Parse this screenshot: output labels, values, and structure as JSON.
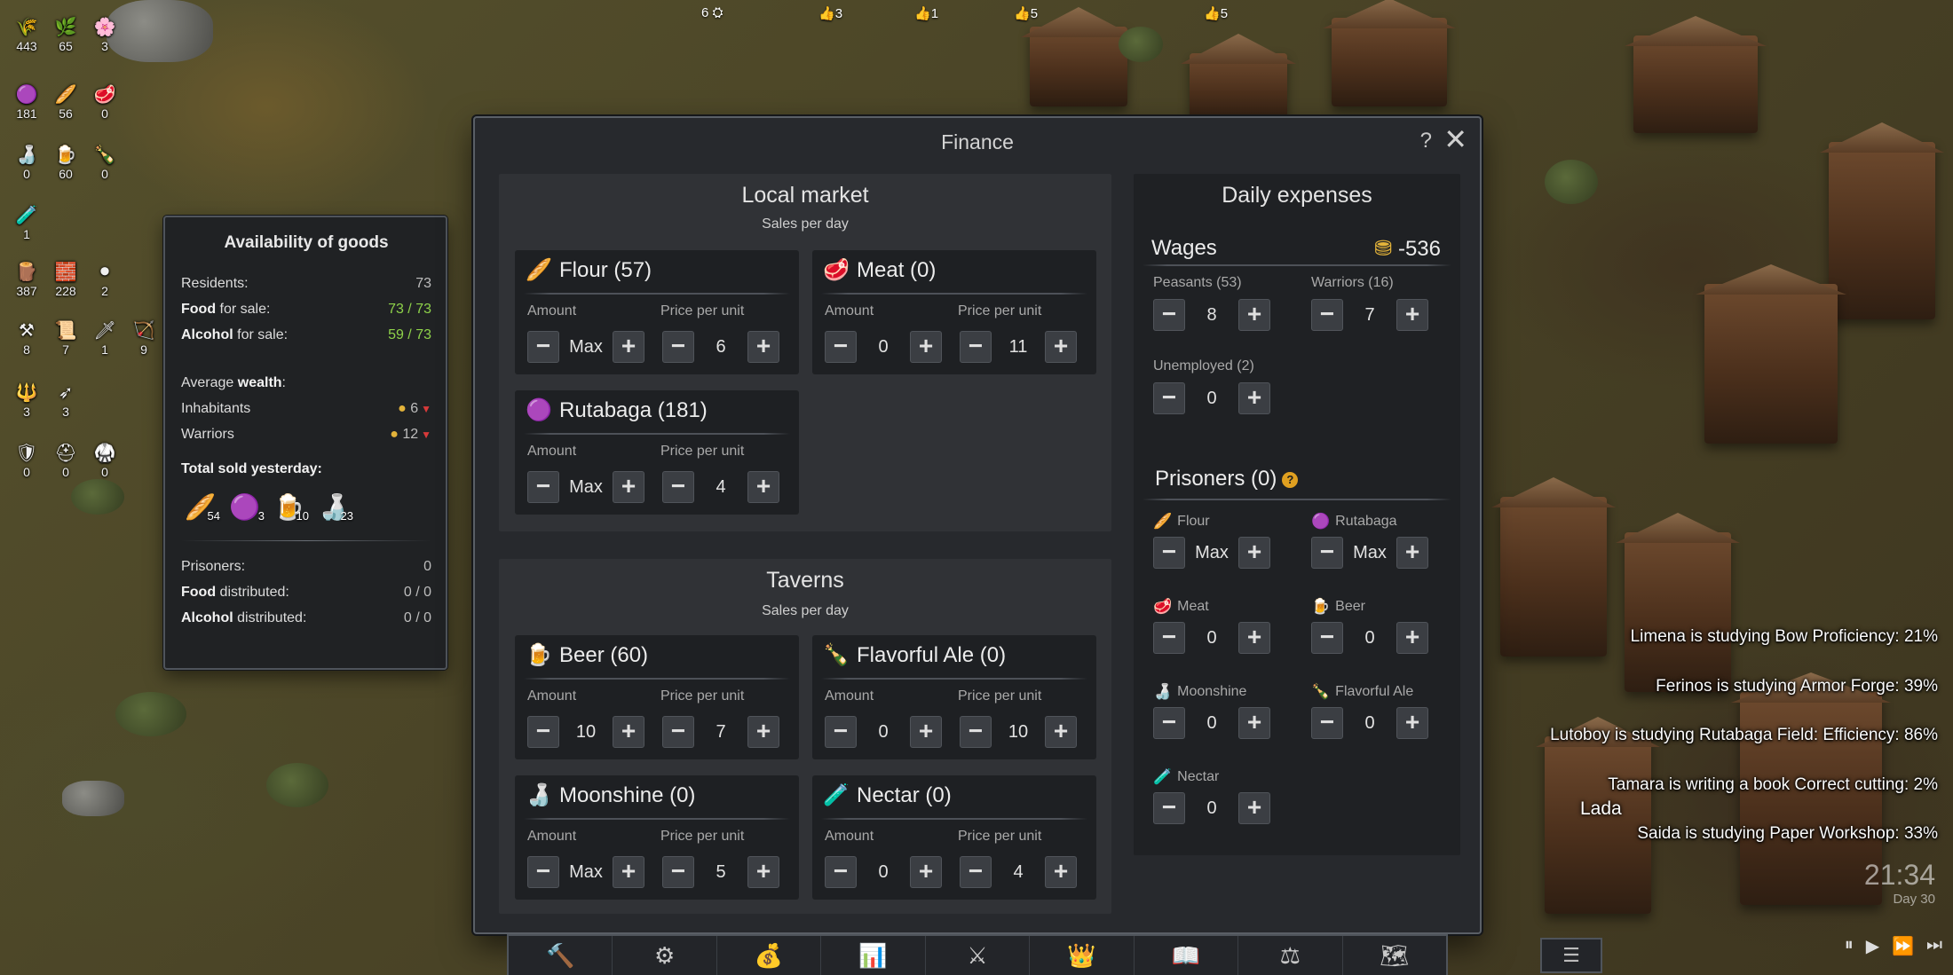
{
  "resources": [
    {
      "icon": "wheat-icon",
      "glyph": "🌾",
      "value": "443"
    },
    {
      "icon": "herb-icon",
      "glyph": "🌿",
      "value": "65"
    },
    {
      "icon": "flower-icon",
      "glyph": "🌸",
      "value": "3"
    },
    {
      "icon": "rutabaga-icon",
      "glyph": "🟣",
      "value": "181"
    },
    {
      "icon": "flour-icon",
      "glyph": "🥖",
      "value": "56"
    },
    {
      "icon": "meat-icon",
      "glyph": "🥩",
      "value": "0"
    },
    {
      "icon": "moonshine-icon",
      "glyph": "🍶",
      "value": "0"
    },
    {
      "icon": "beer-icon",
      "glyph": "🍺",
      "value": "60"
    },
    {
      "icon": "ale-icon",
      "glyph": "🍾",
      "value": "0"
    },
    {
      "icon": "nectar-icon",
      "glyph": "🧪",
      "value": "1"
    },
    {
      "icon": "wood-icon",
      "glyph": "🪵",
      "value": "387"
    },
    {
      "icon": "brick-icon",
      "glyph": "🧱",
      "value": "228"
    },
    {
      "icon": "ore-icon",
      "glyph": "⚫",
      "value": "2"
    },
    {
      "icon": "tools-icon",
      "glyph": "⚒",
      "value": "8"
    },
    {
      "icon": "scroll-icon",
      "glyph": "📜",
      "value": "7"
    },
    {
      "icon": "sword-icon",
      "glyph": "🗡",
      "value": "1"
    },
    {
      "icon": "bow-icon",
      "glyph": "🏹",
      "value": "9"
    },
    {
      "icon": "spear-icon",
      "glyph": "🔱",
      "value": "3"
    },
    {
      "icon": "arrow-icon",
      "glyph": "➶",
      "value": "3"
    },
    {
      "icon": "shield-icon",
      "glyph": "🛡",
      "value": "0"
    },
    {
      "icon": "helmet-icon",
      "glyph": "⛑",
      "value": "0"
    },
    {
      "icon": "armor-icon",
      "glyph": "🥋",
      "value": "0"
    }
  ],
  "top_counters": [
    {
      "icon": "soldier-icon",
      "text": "6"
    },
    {
      "icon": "thumb-icon",
      "text": "3"
    },
    {
      "icon": "thumb-icon",
      "text": "1"
    },
    {
      "icon": "thumb-icon",
      "text": "5"
    },
    {
      "icon": "thumb-icon",
      "text": "5"
    }
  ],
  "availability": {
    "title": "Availability of goods",
    "residents_label": "Residents:",
    "residents_value": "73",
    "food_bold": "Food",
    "food_rest": " for sale:",
    "food_value": "73 / 73",
    "alcohol_bold": "Alcohol",
    "alcohol_rest": " for sale:",
    "alcohol_value": "59 / 73",
    "avg_prefix": "Average ",
    "avg_bold": "wealth",
    "avg_suffix": ":",
    "inhabitants_label": "Inhabitants",
    "inhabitants_value": "6",
    "warriors_label": "Warriors",
    "warriors_value": "12",
    "sold_title": "Total sold yesterday:",
    "sold": [
      {
        "icon": "flour-icon",
        "glyph": "🥖",
        "count": "54"
      },
      {
        "icon": "rutabaga-icon",
        "glyph": "🟣",
        "count": "3"
      },
      {
        "icon": "beer-icon",
        "glyph": "🍺",
        "count": "10"
      },
      {
        "icon": "moonshine-icon",
        "glyph": "🍶",
        "count": "23"
      }
    ],
    "prisoners_label": "Prisoners:",
    "prisoners_value": "0",
    "food_dist_bold": "Food",
    "food_dist_rest": " distributed:",
    "food_dist_value": "0 / 0",
    "alcohol_dist_bold": "Alcohol",
    "alcohol_dist_rest": " distributed:",
    "alcohol_dist_value": "0 / 0"
  },
  "finance": {
    "title": "Finance",
    "help": "?",
    "close": "✕",
    "amount_label": "Amount",
    "price_label": "Price per unit",
    "local_market": {
      "title": "Local market",
      "subtitle": "Sales per day",
      "items": [
        {
          "name": "Flour (57)",
          "icon": "flour-icon",
          "glyph": "🥖",
          "amount": "Max",
          "price": "6"
        },
        {
          "name": "Meat (0)",
          "icon": "meat-icon",
          "glyph": "🥩",
          "amount": "0",
          "price": "11"
        },
        {
          "name": "Rutabaga (181)",
          "icon": "rutabaga-icon",
          "glyph": "🟣",
          "amount": "Max",
          "price": "4"
        }
      ]
    },
    "taverns": {
      "title": "Taverns",
      "subtitle": "Sales per day",
      "items": [
        {
          "name": "Beer (60)",
          "icon": "beer-icon",
          "glyph": "🍺",
          "amount": "10",
          "price": "7"
        },
        {
          "name": "Flavorful Ale (0)",
          "icon": "ale-icon",
          "glyph": "🍾",
          "amount": "0",
          "price": "10"
        },
        {
          "name": "Moonshine (0)",
          "icon": "moonshine-icon",
          "glyph": "🍶",
          "amount": "Max",
          "price": "5"
        },
        {
          "name": "Nectar (0)",
          "icon": "nectar-icon",
          "glyph": "🧪",
          "amount": "0",
          "price": "4"
        }
      ]
    },
    "expenses": {
      "title": "Daily expenses",
      "wages_label": "Wages",
      "wages_value": "-536",
      "peasants_label": "Peasants (53)",
      "peasants_value": "8",
      "warriors_label": "Warriors (16)",
      "warriors_value": "7",
      "unemployed_label": "Unemployed (2)",
      "unemployed_value": "0",
      "prisoners_title": "Prisoners (0)",
      "prisoner_items": [
        {
          "name": "Flour",
          "icon": "flour-icon",
          "glyph": "🥖",
          "value": "Max"
        },
        {
          "name": "Rutabaga",
          "icon": "rutabaga-icon",
          "glyph": "🟣",
          "value": "Max"
        },
        {
          "name": "Meat",
          "icon": "meat-icon",
          "glyph": "🥩",
          "value": "0"
        },
        {
          "name": "Beer",
          "icon": "beer-icon",
          "glyph": "🍺",
          "value": "0"
        },
        {
          "name": "Moonshine",
          "icon": "moonshine-icon",
          "glyph": "🍶",
          "value": "0"
        },
        {
          "name": "Flavorful Ale",
          "icon": "ale-icon",
          "glyph": "🍾",
          "value": "0"
        },
        {
          "name": "Nectar",
          "icon": "nectar-icon",
          "glyph": "🧪",
          "value": "0"
        }
      ]
    }
  },
  "toolbar": [
    {
      "icon": "hammer-icon",
      "glyph": "🔨"
    },
    {
      "icon": "gear-icon",
      "glyph": "⚙"
    },
    {
      "icon": "money-bag-icon",
      "glyph": "💰"
    },
    {
      "icon": "bar-chart-icon",
      "glyph": "📊"
    },
    {
      "icon": "crossed-swords-icon",
      "glyph": "⚔"
    },
    {
      "icon": "crown-icon",
      "glyph": "👑"
    },
    {
      "icon": "book-icon",
      "glyph": "📖"
    },
    {
      "icon": "scales-icon",
      "glyph": "⚖"
    },
    {
      "icon": "map-icon",
      "glyph": "🗺"
    }
  ],
  "menu_icon": "☰",
  "notifications": [
    "Limena is studying Bow Proficiency: 21%",
    "Ferinos is studying Armor Forge: 39%",
    "Lutoboy is studying Rutabaga Field: Efficiency: 86%",
    "Tamara is writing a book Correct cutting: 2%",
    "Saida is studying Paper Workshop: 33%"
  ],
  "villager_name": "Lada",
  "clock": {
    "time": "21:34",
    "day": "Day 30"
  },
  "speed_controls": [
    "⏸",
    "▶",
    "⏩",
    "⏭"
  ]
}
